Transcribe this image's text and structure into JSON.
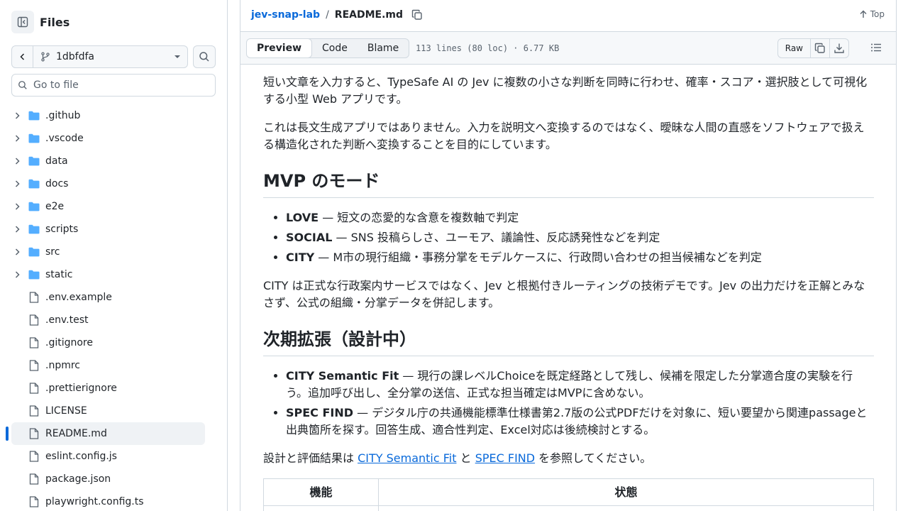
{
  "sidebar": {
    "title": "Files",
    "branch": "1dbfdfa",
    "goto_placeholder": "Go to file",
    "folders": [
      ".github",
      ".vscode",
      "data",
      "docs",
      "e2e",
      "scripts",
      "src",
      "static"
    ],
    "files": [
      ".env.example",
      ".env.test",
      ".gitignore",
      ".npmrc",
      ".prettierignore",
      "LICENSE",
      "README.md",
      "eslint.config.js",
      "package.json",
      "playwright.config.ts"
    ],
    "active_file": "README.md"
  },
  "header": {
    "repo": "jev-snap-lab",
    "separator": "/",
    "file": "README.md",
    "top_label": "Top"
  },
  "filebar": {
    "tabs": [
      "Preview",
      "Code",
      "Blame"
    ],
    "active_tab": "Preview",
    "info": "113 lines (80 loc) · 6.77 KB",
    "raw_label": "Raw"
  },
  "article": {
    "p1": "短い文章を入力すると、TypeSafe AI の Jev に複数の小さな判断を同時に行わせ、確率・スコア・選択肢として可視化する小型 Web アプリです。",
    "p2": "これは長文生成アプリではありません。入力を説明文へ変換するのではなく、曖昧な人間の直感をソフトウェアで扱える構造化された判断へ変換することを目的にしています。",
    "h_modes": "MVP のモード",
    "modes": [
      {
        "name": "LOVE",
        "desc": " — 短文の恋愛的な含意を複数軸で判定"
      },
      {
        "name": "SOCIAL",
        "desc": " — SNS 投稿らしさ、ユーモア、議論性、反応誘発性などを判定"
      },
      {
        "name": "CITY",
        "desc": " — M市の現行組織・事務分掌をモデルケースに、行政問い合わせの担当候補などを判定"
      }
    ],
    "p3": "CITY は正式な行政案内サービスではなく、Jev と根拠付きルーティングの技術デモです。Jev の出力だけを正解とみなさず、公式の組織・分掌データを併記します。",
    "h_next": "次期拡張（設計中）",
    "next": [
      {
        "name": "CITY Semantic Fit",
        "desc": " — 現行の課レベルChoiceを既定経路として残し、候補を限定した分掌適合度の実験を行う。追加呼び出し、全分掌の送信、正式な担当確定はMVPに含めない。"
      },
      {
        "name": "SPEC FIND",
        "desc": " — デジタル庁の共通機能標準仕様書第2.7版の公式PDFだけを対象に、短い要望から関連passageと出典箇所を探す。回答生成、適合性判定、Excel対応は後続検討とする。"
      }
    ],
    "p4_pre": "設計と評価結果は ",
    "link1": "CITY Semantic Fit",
    "p4_mid": " と ",
    "link2": "SPEC FIND",
    "p4_post": " を参照してください。",
    "table_headers": [
      "機能",
      "状態"
    ]
  }
}
